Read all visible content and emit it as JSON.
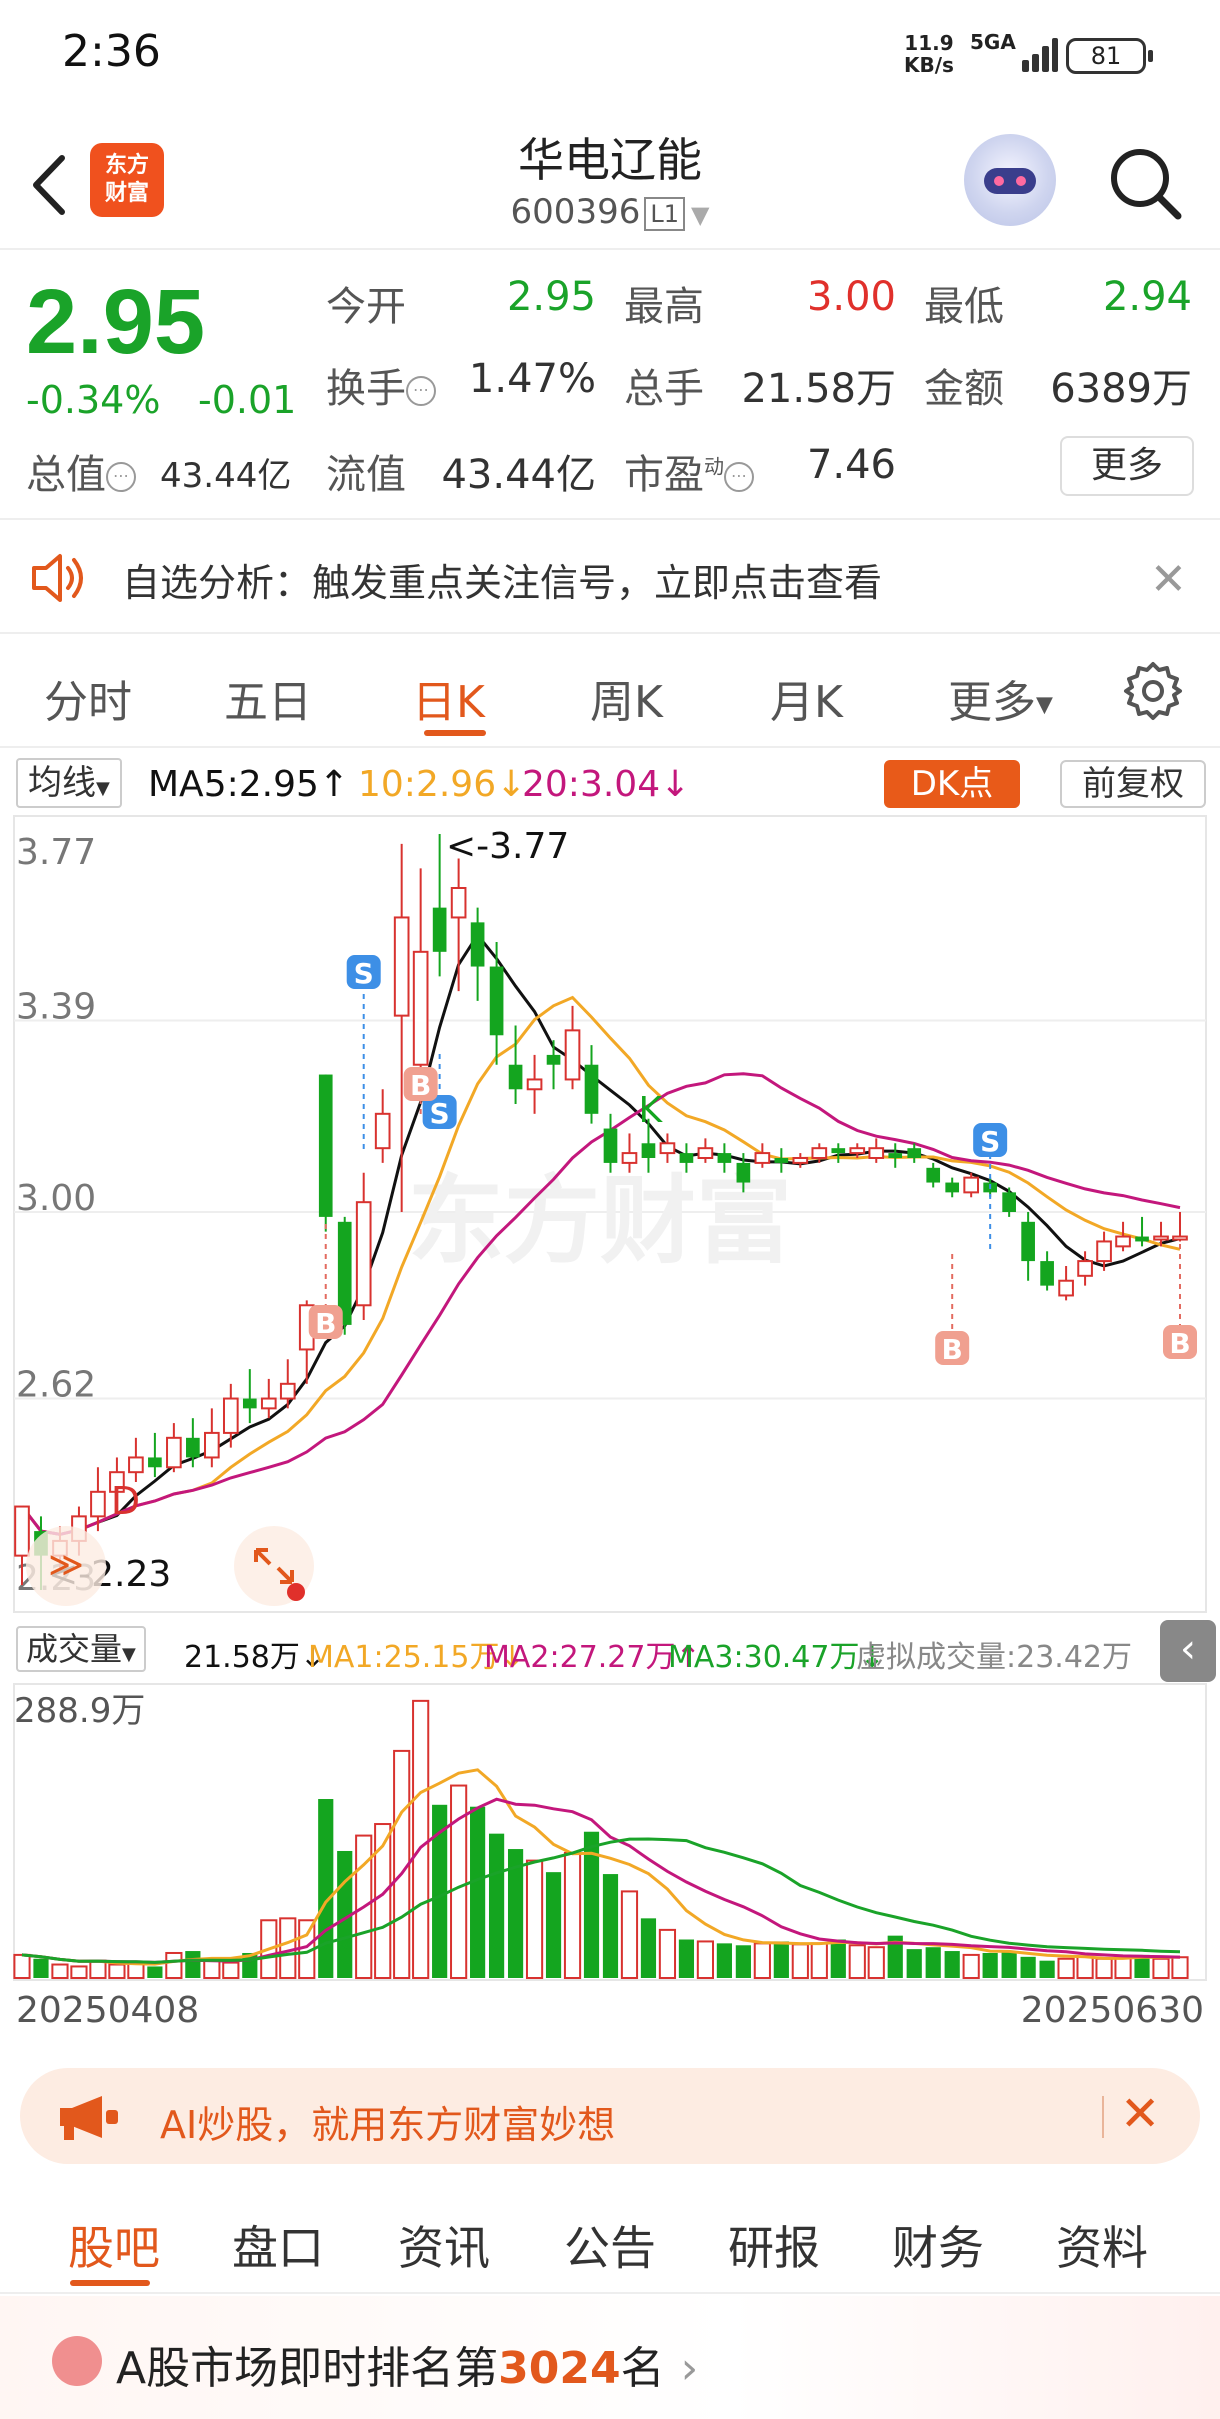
{
  "status_bar": {
    "time": "2:36",
    "net_speed_value": "11.9",
    "net_speed_unit": "KB/s",
    "signal": "5GA",
    "battery": "81"
  },
  "header": {
    "logo_line1": "东方",
    "logo_line2": "财富",
    "stock_name": "华电辽能",
    "stock_code": "600396",
    "level": "L1"
  },
  "quote": {
    "price": "2.95",
    "change_pct": "-0.34%",
    "change_abs": "-0.01",
    "open_label": "今开",
    "open": "2.95",
    "high_label": "最高",
    "high": "3.00",
    "low_label": "最低",
    "low": "2.94",
    "turnover_label": "换手",
    "turnover": "1.47%",
    "volume_label": "总手",
    "volume": "21.58万",
    "amount_label": "金额",
    "amount": "6389万",
    "mktcap_label": "总值",
    "mktcap": "43.44亿",
    "float_label": "流值",
    "float_cap": "43.44亿",
    "pe_label": "市盈",
    "pe_sup": "动",
    "pe": "7.46",
    "more_button": "更多"
  },
  "notice": {
    "text": "自选分析：触发重点关注信号，立即点击查看"
  },
  "tabs": [
    {
      "label": "分时"
    },
    {
      "label": "五日"
    },
    {
      "label": "日K"
    },
    {
      "label": "周K"
    },
    {
      "label": "月K"
    },
    {
      "label": "更多"
    }
  ],
  "ma_row": {
    "select": "均线",
    "ma5": "MA5:2.95↑",
    "ma10": "10:2.96↓",
    "ma20": "20:3.04↓",
    "dk_button": "DK点",
    "adjust_button": "前复权"
  },
  "kchart": {
    "y_labels": [
      "3.77",
      "3.39",
      "3.00",
      "2.62",
      "2.23"
    ],
    "max_marker": "<-3.77",
    "min_marker": "<-2.23",
    "signals": {
      "S": "S",
      "B": "B",
      "D": "D",
      "K": "K"
    },
    "watermark": "东方财富"
  },
  "vol_row": {
    "select": "成交量",
    "vol": "21.58万↓",
    "ma1": "MA1:25.15万↓",
    "ma2": "MA2:27.27万↑",
    "ma3": "MA3:30.47万↓",
    "virtual": "虚拟成交量:23.42万",
    "collapse": "‹"
  },
  "vchart": {
    "max_label": "288.9万"
  },
  "dates": {
    "start": "20250408",
    "end": "20250630"
  },
  "ai_banner": {
    "text": "AI炒股，就用东方财富妙想",
    "close": "✕"
  },
  "bottom_tabs": [
    {
      "label": "股吧"
    },
    {
      "label": "盘口"
    },
    {
      "label": "资讯"
    },
    {
      "label": "公告"
    },
    {
      "label": "研报"
    },
    {
      "label": "财务"
    },
    {
      "label": "资料"
    }
  ],
  "rank": {
    "prefix": "A股市场即时排名第",
    "number": "3024",
    "suffix": "名",
    "arrow": "›"
  },
  "chart_data": {
    "type": "candlestick",
    "title": "",
    "ylim": [
      2.23,
      3.77
    ],
    "candles": [
      [
        2.3,
        2.4,
        2.24,
        2.35
      ],
      [
        2.35,
        2.3,
        2.23,
        2.38
      ],
      [
        2.3,
        2.33,
        2.27,
        2.36
      ],
      [
        2.33,
        2.38,
        2.3,
        2.4
      ],
      [
        2.38,
        2.43,
        2.35,
        2.48
      ],
      [
        2.43,
        2.47,
        2.41,
        2.5
      ],
      [
        2.47,
        2.5,
        2.45,
        2.54
      ],
      [
        2.5,
        2.48,
        2.46,
        2.55
      ],
      [
        2.48,
        2.54,
        2.47,
        2.57
      ],
      [
        2.54,
        2.5,
        2.48,
        2.58
      ],
      [
        2.5,
        2.55,
        2.48,
        2.6
      ],
      [
        2.55,
        2.62,
        2.52,
        2.65
      ],
      [
        2.62,
        2.6,
        2.57,
        2.68
      ],
      [
        2.6,
        2.62,
        2.58,
        2.66
      ],
      [
        2.62,
        2.65,
        2.6,
        2.7
      ],
      [
        2.72,
        2.81,
        2.65,
        2.82
      ],
      [
        3.28,
        2.99,
        2.96,
        3.28
      ],
      [
        2.98,
        2.77,
        2.75,
        2.99
      ],
      [
        2.81,
        3.02,
        2.78,
        3.08
      ],
      [
        3.13,
        3.2,
        3.1,
        3.25
      ],
      [
        3.4,
        3.6,
        3.0,
        3.75
      ],
      [
        3.3,
        3.53,
        3.25,
        3.7
      ],
      [
        3.62,
        3.53,
        3.48,
        3.77
      ],
      [
        3.6,
        3.66,
        3.45,
        3.72
      ],
      [
        3.59,
        3.5,
        3.43,
        3.62
      ],
      [
        3.5,
        3.36,
        3.3,
        3.55
      ],
      [
        3.3,
        3.25,
        3.22,
        3.38
      ],
      [
        3.25,
        3.27,
        3.2,
        3.32
      ],
      [
        3.32,
        3.3,
        3.25,
        3.35
      ],
      [
        3.27,
        3.37,
        3.25,
        3.42
      ],
      [
        3.3,
        3.2,
        3.18,
        3.34
      ],
      [
        3.17,
        3.1,
        3.08,
        3.2
      ],
      [
        3.1,
        3.12,
        3.08,
        3.16
      ],
      [
        3.14,
        3.11,
        3.08,
        3.19
      ],
      [
        3.12,
        3.14,
        3.1,
        3.16
      ],
      [
        3.12,
        3.1,
        3.08,
        3.14
      ],
      [
        3.11,
        3.13,
        3.1,
        3.15
      ],
      [
        3.12,
        3.1,
        3.08,
        3.14
      ],
      [
        3.1,
        3.06,
        3.04,
        3.12
      ],
      [
        3.1,
        3.12,
        3.09,
        3.14
      ],
      [
        3.11,
        3.1,
        3.08,
        3.13
      ],
      [
        3.1,
        3.11,
        3.09,
        3.12
      ],
      [
        3.11,
        3.13,
        3.1,
        3.14
      ],
      [
        3.13,
        3.12,
        3.1,
        3.14
      ],
      [
        3.12,
        3.13,
        3.11,
        3.14
      ],
      [
        3.11,
        3.13,
        3.1,
        3.15
      ],
      [
        3.12,
        3.11,
        3.09,
        3.14
      ],
      [
        3.13,
        3.11,
        3.1,
        3.14
      ],
      [
        3.09,
        3.06,
        3.05,
        3.1
      ],
      [
        3.06,
        3.04,
        3.03,
        3.07
      ],
      [
        3.04,
        3.07,
        3.03,
        3.08
      ],
      [
        3.06,
        3.04,
        3.03,
        3.07
      ],
      [
        3.04,
        3.0,
        2.99,
        3.05
      ],
      [
        2.98,
        2.9,
        2.86,
        3.0
      ],
      [
        2.9,
        2.85,
        2.84,
        2.92
      ],
      [
        2.83,
        2.86,
        2.82,
        2.89
      ],
      [
        2.87,
        2.9,
        2.85,
        2.92
      ],
      [
        2.9,
        2.94,
        2.88,
        2.96
      ],
      [
        2.93,
        2.95,
        2.92,
        2.98
      ],
      [
        2.95,
        2.94,
        2.93,
        2.99
      ],
      [
        2.95,
        2.95,
        2.93,
        2.98
      ],
      [
        2.95,
        2.95,
        2.94,
        3.0
      ]
    ],
    "volumes_wan": [
      24,
      20,
      14,
      12,
      18,
      14,
      16,
      12,
      26,
      28,
      20,
      16,
      26,
      60,
      62,
      60,
      186,
      132,
      148,
      160,
      236,
      288,
      180,
      200,
      178,
      150,
      134,
      122,
      110,
      130,
      152,
      108,
      90,
      62,
      50,
      40,
      38,
      36,
      34,
      36,
      38,
      35,
      36,
      40,
      34,
      32,
      44,
      30,
      32,
      28,
      24,
      26,
      28,
      22,
      18,
      20,
      22,
      20,
      22,
      24,
      20,
      21.58
    ]
  }
}
